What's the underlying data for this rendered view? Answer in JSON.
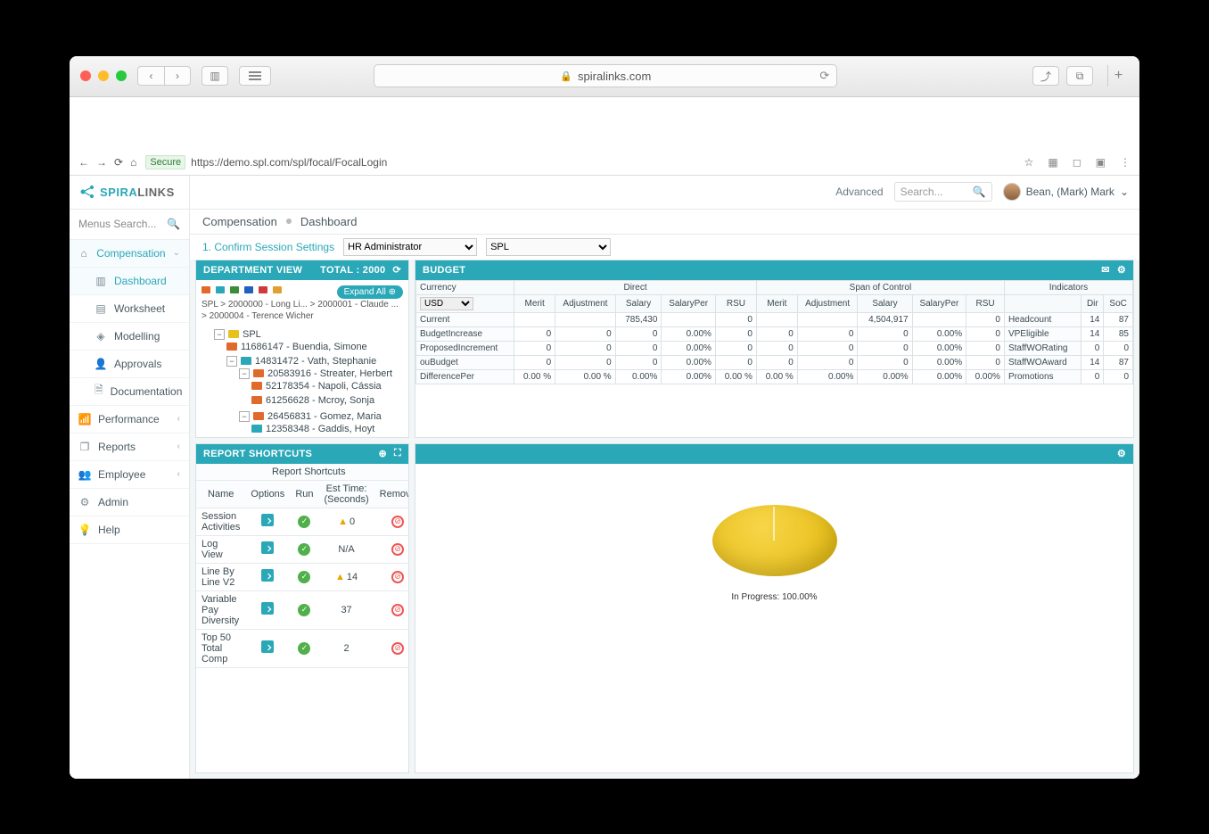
{
  "safari": {
    "domain": "spiralinks.com"
  },
  "inner_url": {
    "secure_label": "Secure",
    "url": "https://demo.spl.com/spl/focal/FocalLogin"
  },
  "brand": {
    "part1": "SPIRA",
    "part2": "LINKS"
  },
  "menusearch": {
    "placeholder": "Menus Search..."
  },
  "sidebar": {
    "items": [
      {
        "label": "Compensation",
        "icon": "home",
        "expanded": true,
        "sub": [
          {
            "label": "Dashboard",
            "icon": "chart",
            "active": true
          },
          {
            "label": "Worksheet",
            "icon": "sheet"
          },
          {
            "label": "Modelling",
            "icon": "diamond"
          },
          {
            "label": "Approvals",
            "icon": "person"
          },
          {
            "label": "Documentation",
            "icon": "doc"
          }
        ]
      },
      {
        "label": "Performance",
        "icon": "signal"
      },
      {
        "label": "Reports",
        "icon": "layers"
      },
      {
        "label": "Employee",
        "icon": "user"
      },
      {
        "label": "Admin",
        "icon": "gear"
      },
      {
        "label": "Help",
        "icon": "bulb"
      }
    ]
  },
  "topbar": {
    "advanced": "Advanced",
    "search_placeholder": "Search...",
    "user": "Bean, (Mark) Mark"
  },
  "breadcrumb": {
    "a": "Compensation",
    "b": "Dashboard"
  },
  "session": {
    "confirm": "1. Confirm Session Settings",
    "role": "HR Administrator",
    "org": "SPL"
  },
  "dept": {
    "title": "DEPARTMENT VIEW",
    "total_label": "TOTAL : 2000",
    "expand": "Expand All",
    "path": "SPL > 2000000 - Long Li... > 2000001 - Claude ... > 2000004 - Terence Wicher",
    "legend_colors": [
      "#e06a2b",
      "#2aa8b8",
      "#3a8e3a",
      "#2060c0",
      "#d03a3a",
      "#e0a030"
    ],
    "tree": {
      "root": "SPL",
      "nodes": [
        {
          "color": "#e06a2b",
          "label": "11686147 - Buendia, Simone"
        },
        {
          "color": "#2aa8b8",
          "label": "14831472 - Vath, Stephanie",
          "children": [
            {
              "color": "#e06a2b",
              "label": "20583916 - Streater, Herbert",
              "children": [
                {
                  "color": "#e06a2b",
                  "label": "52178354 - Napoli, Cássia"
                },
                {
                  "color": "#e06a2b",
                  "label": "61256628 - Mcroy, Sonja"
                }
              ]
            },
            {
              "color": "#e06a2b",
              "label": "26456831 - Gomez, Maria",
              "children": [
                {
                  "color": "#2aa8b8",
                  "label": "12358348 - Gaddis, Hoyt"
                }
              ]
            }
          ]
        }
      ]
    }
  },
  "budget": {
    "title": "BUDGET",
    "groups": {
      "currency": "Currency",
      "direct": "Direct",
      "span": "Span of Control",
      "indicators": "Indicators"
    },
    "currency_value": "USD",
    "cols_direct": [
      "Merit",
      "Adjustment",
      "Salary",
      "SalaryPer",
      "RSU"
    ],
    "cols_span": [
      "Merit",
      "Adjustment",
      "Salary",
      "SalaryPer",
      "RSU"
    ],
    "cols_ind": [
      "",
      "Dir",
      "SoC"
    ],
    "rows": [
      {
        "label": "Current",
        "direct": [
          "",
          "",
          "785,430",
          "",
          "0"
        ],
        "span": [
          "",
          "",
          "4,504,917",
          "",
          "0"
        ]
      },
      {
        "label": "BudgetIncrease",
        "direct": [
          "0",
          "0",
          "0",
          "0.00%",
          "0"
        ],
        "span": [
          "0",
          "0",
          "0",
          "0.00%",
          "0"
        ]
      },
      {
        "label": "ProposedIncrement",
        "direct": [
          "0",
          "0",
          "0",
          "0.00%",
          "0"
        ],
        "span": [
          "0",
          "0",
          "0",
          "0.00%",
          "0"
        ]
      },
      {
        "label": "ouBudget",
        "direct": [
          "0",
          "0",
          "0",
          "0.00%",
          "0"
        ],
        "span": [
          "0",
          "0",
          "0",
          "0.00%",
          "0"
        ]
      },
      {
        "label": "DifferencePer",
        "direct": [
          "0.00 %",
          "0.00 %",
          "0.00%",
          "0.00%",
          "0.00 %"
        ],
        "span": [
          "0.00 %",
          "0.00%",
          "0.00%",
          "0.00%",
          "0.00%"
        ]
      }
    ],
    "indicators": [
      {
        "label": "Headcount",
        "dir": "14",
        "soc": "87"
      },
      {
        "label": "VPEligible",
        "dir": "14",
        "soc": "85"
      },
      {
        "label": "StaffWORating",
        "dir": "0",
        "soc": "0"
      },
      {
        "label": "StaffWOAward",
        "dir": "14",
        "soc": "87"
      },
      {
        "label": "Promotions",
        "dir": "0",
        "soc": "0"
      }
    ]
  },
  "shortcuts": {
    "title": "REPORT SHORTCUTS",
    "header": "Report Shortcuts",
    "cols": [
      "Name",
      "Options",
      "Run",
      "Est Time: (Seconds)",
      "Remove"
    ],
    "rows": [
      {
        "name": "Session Activities",
        "est": "0",
        "warn": true
      },
      {
        "name": "Log View",
        "est": "N/A",
        "warn": false
      },
      {
        "name": "Line By Line V2",
        "est": "14",
        "warn": true
      },
      {
        "name": "Variable Pay Diversity",
        "est": "37",
        "warn": false
      },
      {
        "name": "Top 50 Total Comp",
        "est": "2",
        "warn": false
      }
    ]
  },
  "chart_data": {
    "type": "pie",
    "series": [
      {
        "name": "In Progress",
        "value": 100.0
      }
    ],
    "label": "In Progress: 100.00%"
  }
}
